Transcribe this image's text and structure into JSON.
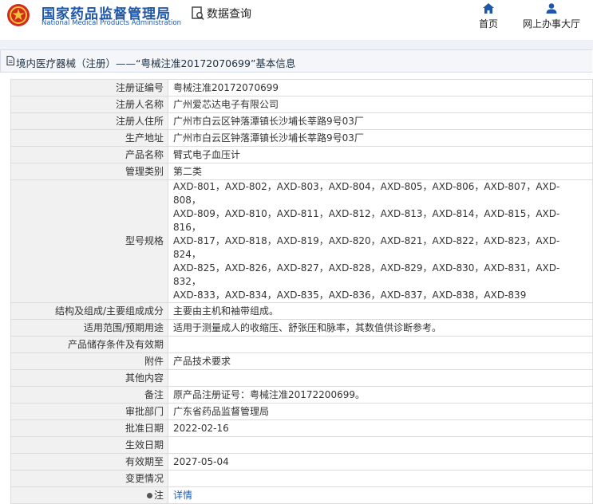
{
  "header": {
    "brand_cn": "国家药品监督管理局",
    "brand_en": "National Medical Products Administration",
    "search_label": "数据查询",
    "nav": [
      {
        "label": "首页",
        "icon": "home-icon"
      },
      {
        "label": "网上办事大厅",
        "icon": "user-icon"
      }
    ]
  },
  "title": "境内医疗器械（注册）——“粤械注准20172070699”基本信息",
  "rows": [
    {
      "key": "注册证编号",
      "value": "粤械注准20172070699"
    },
    {
      "key": "注册人名称",
      "value": "广州爱芯达电子有限公司"
    },
    {
      "key": "注册人住所",
      "value": "广州市白云区钟落潭镇长沙埔长莘路9号03厂"
    },
    {
      "key": "生产地址",
      "value": "广州市白云区钟落潭镇长沙埔长莘路9号03厂"
    },
    {
      "key": "产品名称",
      "value": "臂式电子血压计"
    },
    {
      "key": "管理类别",
      "value": "第二类"
    }
  ],
  "model": {
    "key": "型号规格",
    "lines": [
      "AXD-801，AXD-802，AXD-803，AXD-804，AXD-805，AXD-806，AXD-807，AXD-808，",
      "AXD-809，AXD-810，AXD-811，AXD-812，AXD-813，AXD-814，AXD-815，AXD-816，",
      "AXD-817，AXD-818，AXD-819，AXD-820，AXD-821，AXD-822，AXD-823，AXD-824，",
      "AXD-825，AXD-826，AXD-827，AXD-828，AXD-829，AXD-830，AXD-831，AXD-832，",
      "AXD-833，AXD-834，AXD-835，AXD-836，AXD-837，AXD-838，AXD-839"
    ]
  },
  "rows2": [
    {
      "key": "结构及组成/主要组成成分",
      "value": "主要由主机和袖带组成。"
    },
    {
      "key": "适用范围/预期用途",
      "value": "适用于测量成人的收缩压、舒张压和脉率，其数值供诊断参考。"
    },
    {
      "key": "产品储存条件及有效期",
      "value": ""
    },
    {
      "key": "附件",
      "value": "产品技术要求"
    },
    {
      "key": "其他内容",
      "value": ""
    },
    {
      "key": "备注",
      "value": "原产品注册证号：粤械注准20172200699。"
    },
    {
      "key": "审批部门",
      "value": "广东省药品监督管理局"
    },
    {
      "key": "批准日期",
      "value": "2022-02-16"
    },
    {
      "key": "生效日期",
      "value": ""
    },
    {
      "key": "有效期至",
      "value": "2027-05-04"
    },
    {
      "key": "变更情况",
      "value": ""
    }
  ],
  "note": {
    "key": "注",
    "link": "详情"
  },
  "colors": {
    "brand": "#1e56a8",
    "link": "#1a5fb4",
    "emblem_red": "#d42a1e"
  }
}
